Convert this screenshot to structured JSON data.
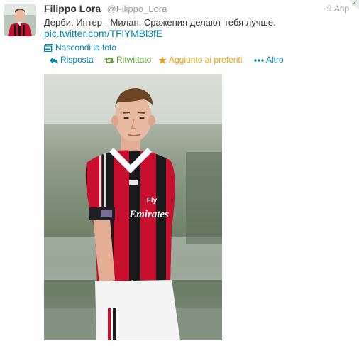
{
  "tweet": {
    "fullname": "Filippo Lora",
    "username": "@Filippo_Lora",
    "timestamp": "9 Апр",
    "text": "Дерби. Интер - Милан. Сражения делают тебя лучше.",
    "link": "pic.twitter.com/TFlYMBl3fE",
    "hide_photo": "Nascondi la foto"
  },
  "actions": {
    "reply": "Risposta",
    "retweet": "Ritwittato",
    "favorite": "Aggiunto ai preferiti",
    "more": "Altro"
  },
  "photo": {
    "shirt_sponsor_line1": "Fly",
    "shirt_sponsor_line2": "Emirates"
  },
  "colors": {
    "link": "#0084b4",
    "retweeted": "#5a9e2f",
    "favorited": "#e8a317",
    "text": "#333333",
    "muted": "#999999"
  },
  "icons": {
    "reply": "reply-arrow-icon",
    "retweet": "retweet-icon",
    "favorite": "star-icon",
    "more": "more-dots-icon",
    "hide_photo": "photo-icon"
  }
}
